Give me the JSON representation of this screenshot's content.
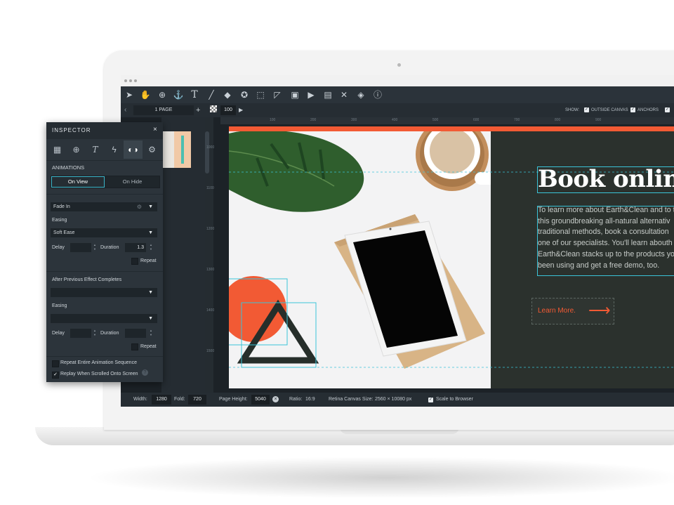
{
  "toolbar": {
    "icons": [
      "pointer-icon",
      "hand-icon",
      "zoom-icon",
      "anchor-icon",
      "text-icon",
      "line-icon",
      "shape-icon",
      "star-icon",
      "frame-icon",
      "path-icon",
      "image-icon",
      "video-icon",
      "embed-icon",
      "tools-icon",
      "layers-icon",
      "info-icon"
    ]
  },
  "subbar": {
    "page_tab": "1 PAGE",
    "add_page": "+",
    "zoom": "100",
    "show_label": "SHOW:",
    "outside_canvas": "OUTSIDE CANVAS",
    "anchors": "ANCHORS"
  },
  "ruler": {
    "top": [
      "100",
      "200",
      "300",
      "400",
      "500",
      "600",
      "700",
      "800",
      "900"
    ],
    "left": [
      "1000",
      "1100",
      "1200",
      "1300",
      "1400",
      "1500"
    ]
  },
  "inspector": {
    "title": "INSPECTOR",
    "close": "×",
    "animations_label": "ANIMATIONS",
    "on_view": "On View",
    "on_hide": "On Hide",
    "effect": "Fade In",
    "easing_label": "Easing",
    "easing_value": "Soft Ease",
    "delay_label": "Delay",
    "duration_label": "Duration",
    "duration_value": "1.3",
    "repeat_label": "Repeat",
    "after_label": "After Previous Effect Completes",
    "easing2_label": "Easing",
    "delay2_label": "Delay",
    "duration2_label": "Duration",
    "repeat2_label": "Repeat",
    "repeat_sequence_label": "Repeat Entire Animation Sequence",
    "replay_label": "Replay When Scrolled Onto Screen",
    "help": "?"
  },
  "design": {
    "headline": "Book online.",
    "body_lines": [
      "To learn more about Earth&Clean and to t",
      "this groundbreaking all-natural alternativ",
      "traditional methods, book a consultation",
      "one of our specialists. You'll learn abouth",
      "Earth&Clean stacks up to the products yo",
      "been using and get a free demo, too."
    ],
    "cta_label": "Learn More.",
    "cta_arrow": "⟶",
    "colors": {
      "orange": "#f25a34",
      "dark_green": "#2b312d",
      "selection": "#3bc4d8"
    }
  },
  "statusbar": {
    "width_label": "Width:",
    "width_value": "1280",
    "fold_label": "Fold:",
    "fold_value": "720",
    "page_height_label": "Page Height:",
    "page_height_value": "5040",
    "ratio_label": "Ratio:",
    "ratio_value": "16:9",
    "retina_label": "Retina Canvas Size:",
    "retina_value": "2560 × 10080 px",
    "scale_label": "Scale to Browser"
  }
}
